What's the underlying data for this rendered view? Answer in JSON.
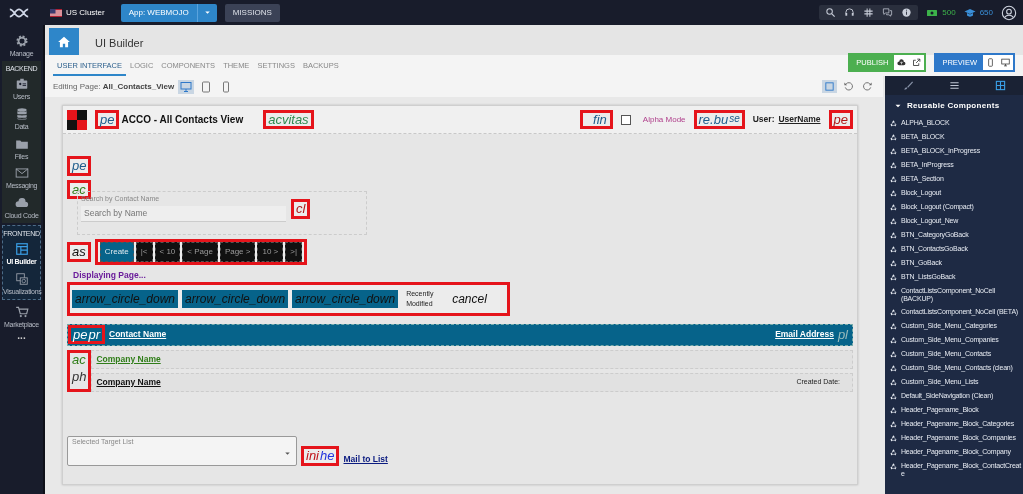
{
  "topbar": {
    "cluster": "US Cluster",
    "app_button": "App: WEBMOJO",
    "missions": "MISSIONS",
    "coins": "500",
    "points": "650"
  },
  "sidebar": [
    {
      "kind": "item",
      "label": "Manage",
      "selected": false
    },
    {
      "kind": "group",
      "title": "BACKEND",
      "items": [
        {
          "label": "Users",
          "selected": false
        },
        {
          "label": "Data",
          "selected": false
        },
        {
          "label": "Files",
          "selected": false
        },
        {
          "label": "Messaging",
          "selected": false
        },
        {
          "label": "Cloud Code",
          "selected": false
        }
      ]
    },
    {
      "kind": "frontend",
      "title": "FRONTEND",
      "items": [
        {
          "label": "UI Builder",
          "selected": true
        },
        {
          "label": "Visualizations",
          "selected": false
        }
      ]
    },
    {
      "kind": "item",
      "label": "Marketplace",
      "selected": false
    },
    {
      "kind": "more",
      "label": "..."
    }
  ],
  "header": {
    "title": "UI Builder"
  },
  "tabs": [
    {
      "label": "USER INTERFACE",
      "selected": true
    },
    {
      "label": "LOGIC",
      "selected": false
    },
    {
      "label": "COMPONENTS",
      "selected": false
    },
    {
      "label": "THEME",
      "selected": false
    },
    {
      "label": "SETTINGS",
      "selected": false
    },
    {
      "label": "BACKUPS",
      "selected": false
    }
  ],
  "publish": "PUBLISH",
  "preview": "PREVIEW",
  "editing": {
    "label": "Editing Page:",
    "page": "All_Contacts_View",
    "devices": [
      {
        "selected": true
      },
      {
        "selected": false
      },
      {
        "selected": false
      }
    ]
  },
  "canvas": {
    "logo_frame": [
      "pe"
    ],
    "title": "ACCO - All Contacts View",
    "title_frame": [
      "acvitas"
    ],
    "find_frame": [
      "fin"
    ],
    "alpha_mode": {
      "label": "Alpha Mode",
      "checked": false
    },
    "mode_frame": [
      "re.bu",
      "se"
    ],
    "user_label": "User:",
    "user_name": "UserName",
    "user_frame": [
      "pe"
    ],
    "side_frames": [
      [
        "pe"
      ],
      [
        "ac"
      ]
    ],
    "search": {
      "label": "Search by Contact Name",
      "placeholder": "Search by Name",
      "frame": [
        "cl"
      ]
    },
    "pager": {
      "frame": [
        "as"
      ],
      "buttons": [
        {
          "label": "Create",
          "kind": "primary"
        },
        {
          "label": "|<",
          "kind": "dark"
        },
        {
          "label": "< 10",
          "kind": "dark"
        },
        {
          "label": "< Page",
          "kind": "dark"
        },
        {
          "label": "Page >",
          "kind": "dark"
        },
        {
          "label": "10 >",
          "kind": "dark"
        },
        {
          "label": ">|",
          "kind": "dark"
        }
      ]
    },
    "status": "Displaying Page...",
    "sort": {
      "buttons": [
        "arrow_circle_down",
        "arrow_circle_down",
        "arrow_circle_down"
      ],
      "recent": "Recently Modified",
      "cancel": "cancel"
    },
    "table": {
      "header_frame": [
        "pe",
        "pr"
      ],
      "columns": [
        "Contact Name",
        "Email Address"
      ],
      "header_tail": "pl",
      "row_frame": [
        "ac",
        "ph"
      ],
      "rows": [
        {
          "name": "Company Name",
          "kind": "green"
        },
        {
          "name": "Company Name",
          "kind": "plain",
          "date": "Created Date:"
        }
      ]
    },
    "footer": {
      "select_label": "Selected Target List",
      "frame": [
        "ini",
        "he"
      ],
      "link": "Mail to List"
    }
  },
  "components": {
    "title": "Reusable Components",
    "items": [
      "ALPHA_BLOCK",
      "BETA_BLOCK",
      "BETA_BLOCK_InProgress",
      "BETA_InProgress",
      "BETA_Section",
      "Block_Logout",
      "Block_Logout (Compact)",
      "Block_Logout_New",
      "BTN_CategoryGoBack",
      "BTN_ContactsGoBack",
      "BTN_GoBack",
      "BTN_ListsGoBack",
      "ContactListsComponent_NoCell (BACKUP)",
      "ContactListsComponent_NoCell (BETA)",
      "Custom_Side_Menu_Categories",
      "Custom_Side_Menu_Companies",
      "Custom_Side_Menu_Contacts",
      "Custom_Side_Menu_Contacts (clean)",
      "Custom_Side_Menu_Lists",
      "Default_SideNavigation (Clean)",
      "Header_Pagename_Block",
      "Header_Pagename_Block_Categories",
      "Header_Pagename_Block_Companies",
      "Header_Pagename_Block_Company",
      "Header_Pagename_Block_ContactCreate"
    ]
  }
}
